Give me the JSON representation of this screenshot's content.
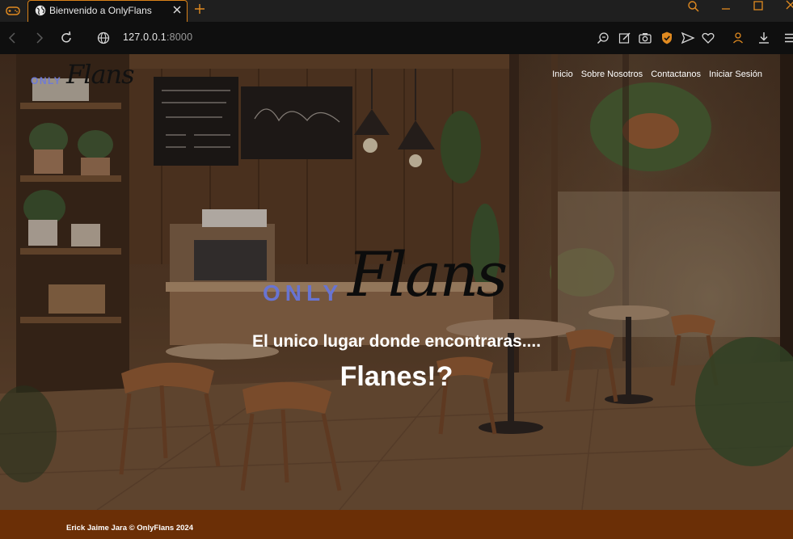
{
  "browser": {
    "tab": {
      "title": "Bienvenido a OnlyFlans"
    },
    "address": {
      "host": "127.0.0.1",
      "port": ":8000"
    },
    "accent": "#d98219",
    "icons": [
      "gamepad-icon",
      "globe-icon",
      "close-icon",
      "plus-icon",
      "search-icon",
      "minimize-icon",
      "maximize-icon",
      "close-window-icon",
      "back-icon",
      "forward-icon",
      "reload-icon",
      "site-info-icon",
      "zoom-icon",
      "edit-icon",
      "camera-icon",
      "shield-icon",
      "send-icon",
      "heart-icon",
      "user-icon",
      "download-icon",
      "menu-icon"
    ]
  },
  "site": {
    "brand": {
      "only": "ONLY",
      "flans": "Flans"
    },
    "nav": [
      {
        "label": "Inicio"
      },
      {
        "label": "Sobre Nosotros"
      },
      {
        "label": "Contactanos"
      },
      {
        "label": "Iniciar Sesión"
      }
    ],
    "hero": {
      "logo": {
        "only": "ONLY",
        "flans": "Flans"
      },
      "tagline": "El unico lugar donde encontraras....",
      "headline": "Flanes!?"
    },
    "footer": {
      "text": "Erick Jaime Jara © OnlyFlans 2024"
    },
    "colors": {
      "brand_blue": "#6f7bd6",
      "footer_brown": "#6b2f06"
    }
  }
}
